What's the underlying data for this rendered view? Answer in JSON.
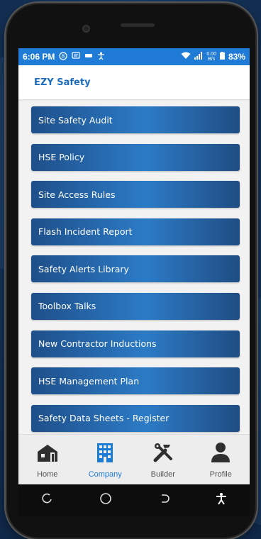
{
  "status": {
    "time": "6:06 PM",
    "speed_value": "0.00",
    "speed_unit": "B/s",
    "battery": "83%"
  },
  "app": {
    "title": "EZY Safety"
  },
  "menu": {
    "items": [
      {
        "label": "Site Safety Audit"
      },
      {
        "label": "HSE Policy"
      },
      {
        "label": "Site Access Rules"
      },
      {
        "label": "Flash Incident Report"
      },
      {
        "label": "Safety Alerts Library"
      },
      {
        "label": "Toolbox Talks"
      },
      {
        "label": "New Contractor Inductions"
      },
      {
        "label": "HSE Management Plan"
      },
      {
        "label": "Safety Data Sheets - Register"
      }
    ]
  },
  "bottom_nav": {
    "items": [
      {
        "label": "Home",
        "icon": "home-icon",
        "active": false
      },
      {
        "label": "Company",
        "icon": "building-icon",
        "active": true
      },
      {
        "label": "Builder",
        "icon": "tools-icon",
        "active": false
      },
      {
        "label": "Profile",
        "icon": "person-icon",
        "active": false
      }
    ]
  },
  "colors": {
    "status_bar": "#1f7bd6",
    "title": "#1c6dbe",
    "active_nav": "#1c7bd4",
    "button_dark": "#1e4f8a",
    "button_light": "#2c7bc6"
  }
}
